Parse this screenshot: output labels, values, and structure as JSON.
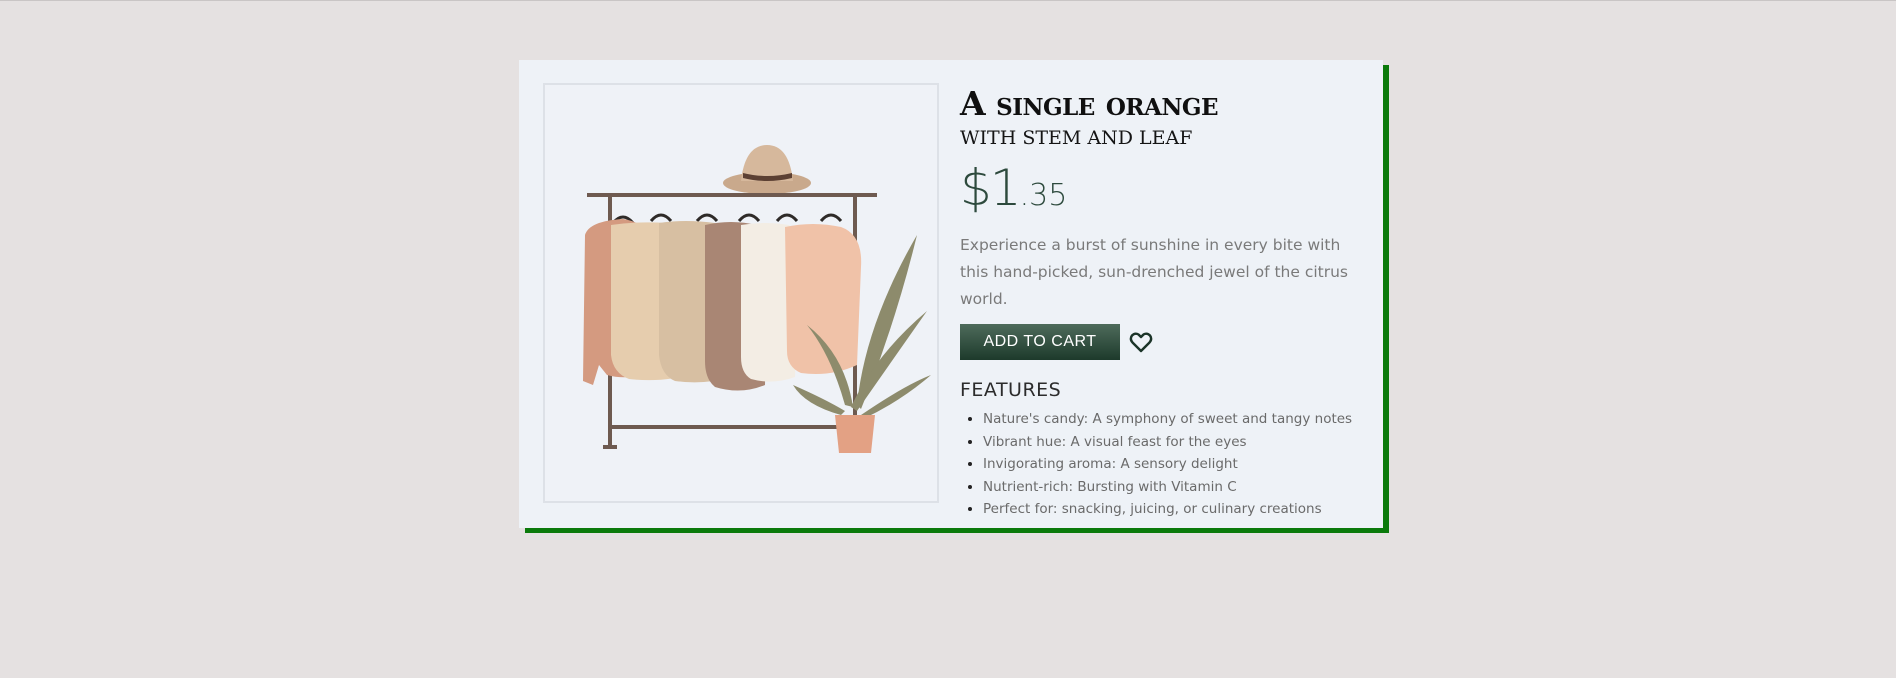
{
  "product": {
    "title": "A single orange",
    "subtitle": "WITH STEM AND LEAF",
    "price_whole": "$1",
    "price_cents": ".35",
    "description": "Experience a burst of sunshine in every bite with this hand-picked, sun-drenched jewel of the citrus world.",
    "image_icon": "clothing-rack-illustration"
  },
  "actions": {
    "add_to_cart_label": "ADD TO CART",
    "favorite_icon": "heart-icon"
  },
  "features": {
    "heading": "FEATURES",
    "items": [
      "Nature's candy: A symphony of sweet and tangy notes",
      "Vibrant hue: A visual feast for the eyes",
      "Invigorating aroma: A sensory delight",
      "Nutrient-rich: Bursting with Vitamin C",
      "Perfect for: snacking, juicing, or culinary creations"
    ]
  },
  "colors": {
    "page_background": "#e5e1e1",
    "card_background": "#eef2f7",
    "card_shadow": "#0b7a0b",
    "button": "#2d4a3d",
    "price": "#2d4a3d"
  }
}
